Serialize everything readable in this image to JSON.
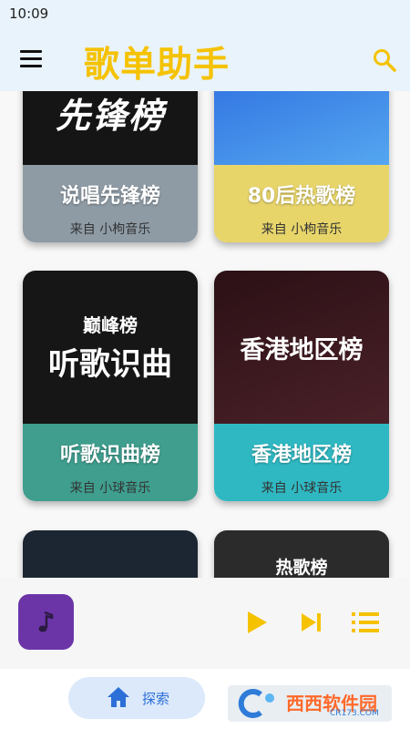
{
  "status_bar": {
    "time": "10:09"
  },
  "app_bar": {
    "title": "歌单助手"
  },
  "cards": [
    {
      "cover_text": "先锋榜",
      "title": "说唱先锋榜",
      "source": "来自 小枸音乐",
      "cover_color": "#151515",
      "bottom_color": "#8e9ba5"
    },
    {
      "cover_text": "",
      "title": "80后热歌榜",
      "source": "来自 小枸音乐",
      "cover_color": "#3f8de9",
      "bottom_color": "#e8d56a"
    },
    {
      "cover_text": "听歌识曲",
      "cover_badge": "巅峰榜",
      "title": "听歌识曲榜",
      "source": "来自 小球音乐",
      "cover_color": "#161616",
      "bottom_color": "#3f9e8e"
    },
    {
      "cover_text": "香港地区榜",
      "title": "香港地区榜",
      "source": "来自 小球音乐",
      "cover_color": "#3a171c",
      "bottom_color": "#2fb8c2"
    },
    {
      "cover_text": "",
      "title": "",
      "source": "",
      "cover_color": "#1b2632",
      "bottom_color": "#1b2632"
    },
    {
      "cover_text": "热歌榜",
      "title": "",
      "source": "",
      "cover_color": "#2b2b2b",
      "bottom_color": "#2b2b2b"
    }
  ],
  "player": {
    "thumb_icon": "music-note-icon"
  },
  "bottom_nav": {
    "explore_label": "探索"
  },
  "watermark": {
    "text": "西西软件园",
    "sub": "CR173.COM"
  },
  "colors": {
    "accent": "#f5c200",
    "nav_active_bg": "#dbe9fb",
    "nav_active_text": "#2c6fd6"
  }
}
